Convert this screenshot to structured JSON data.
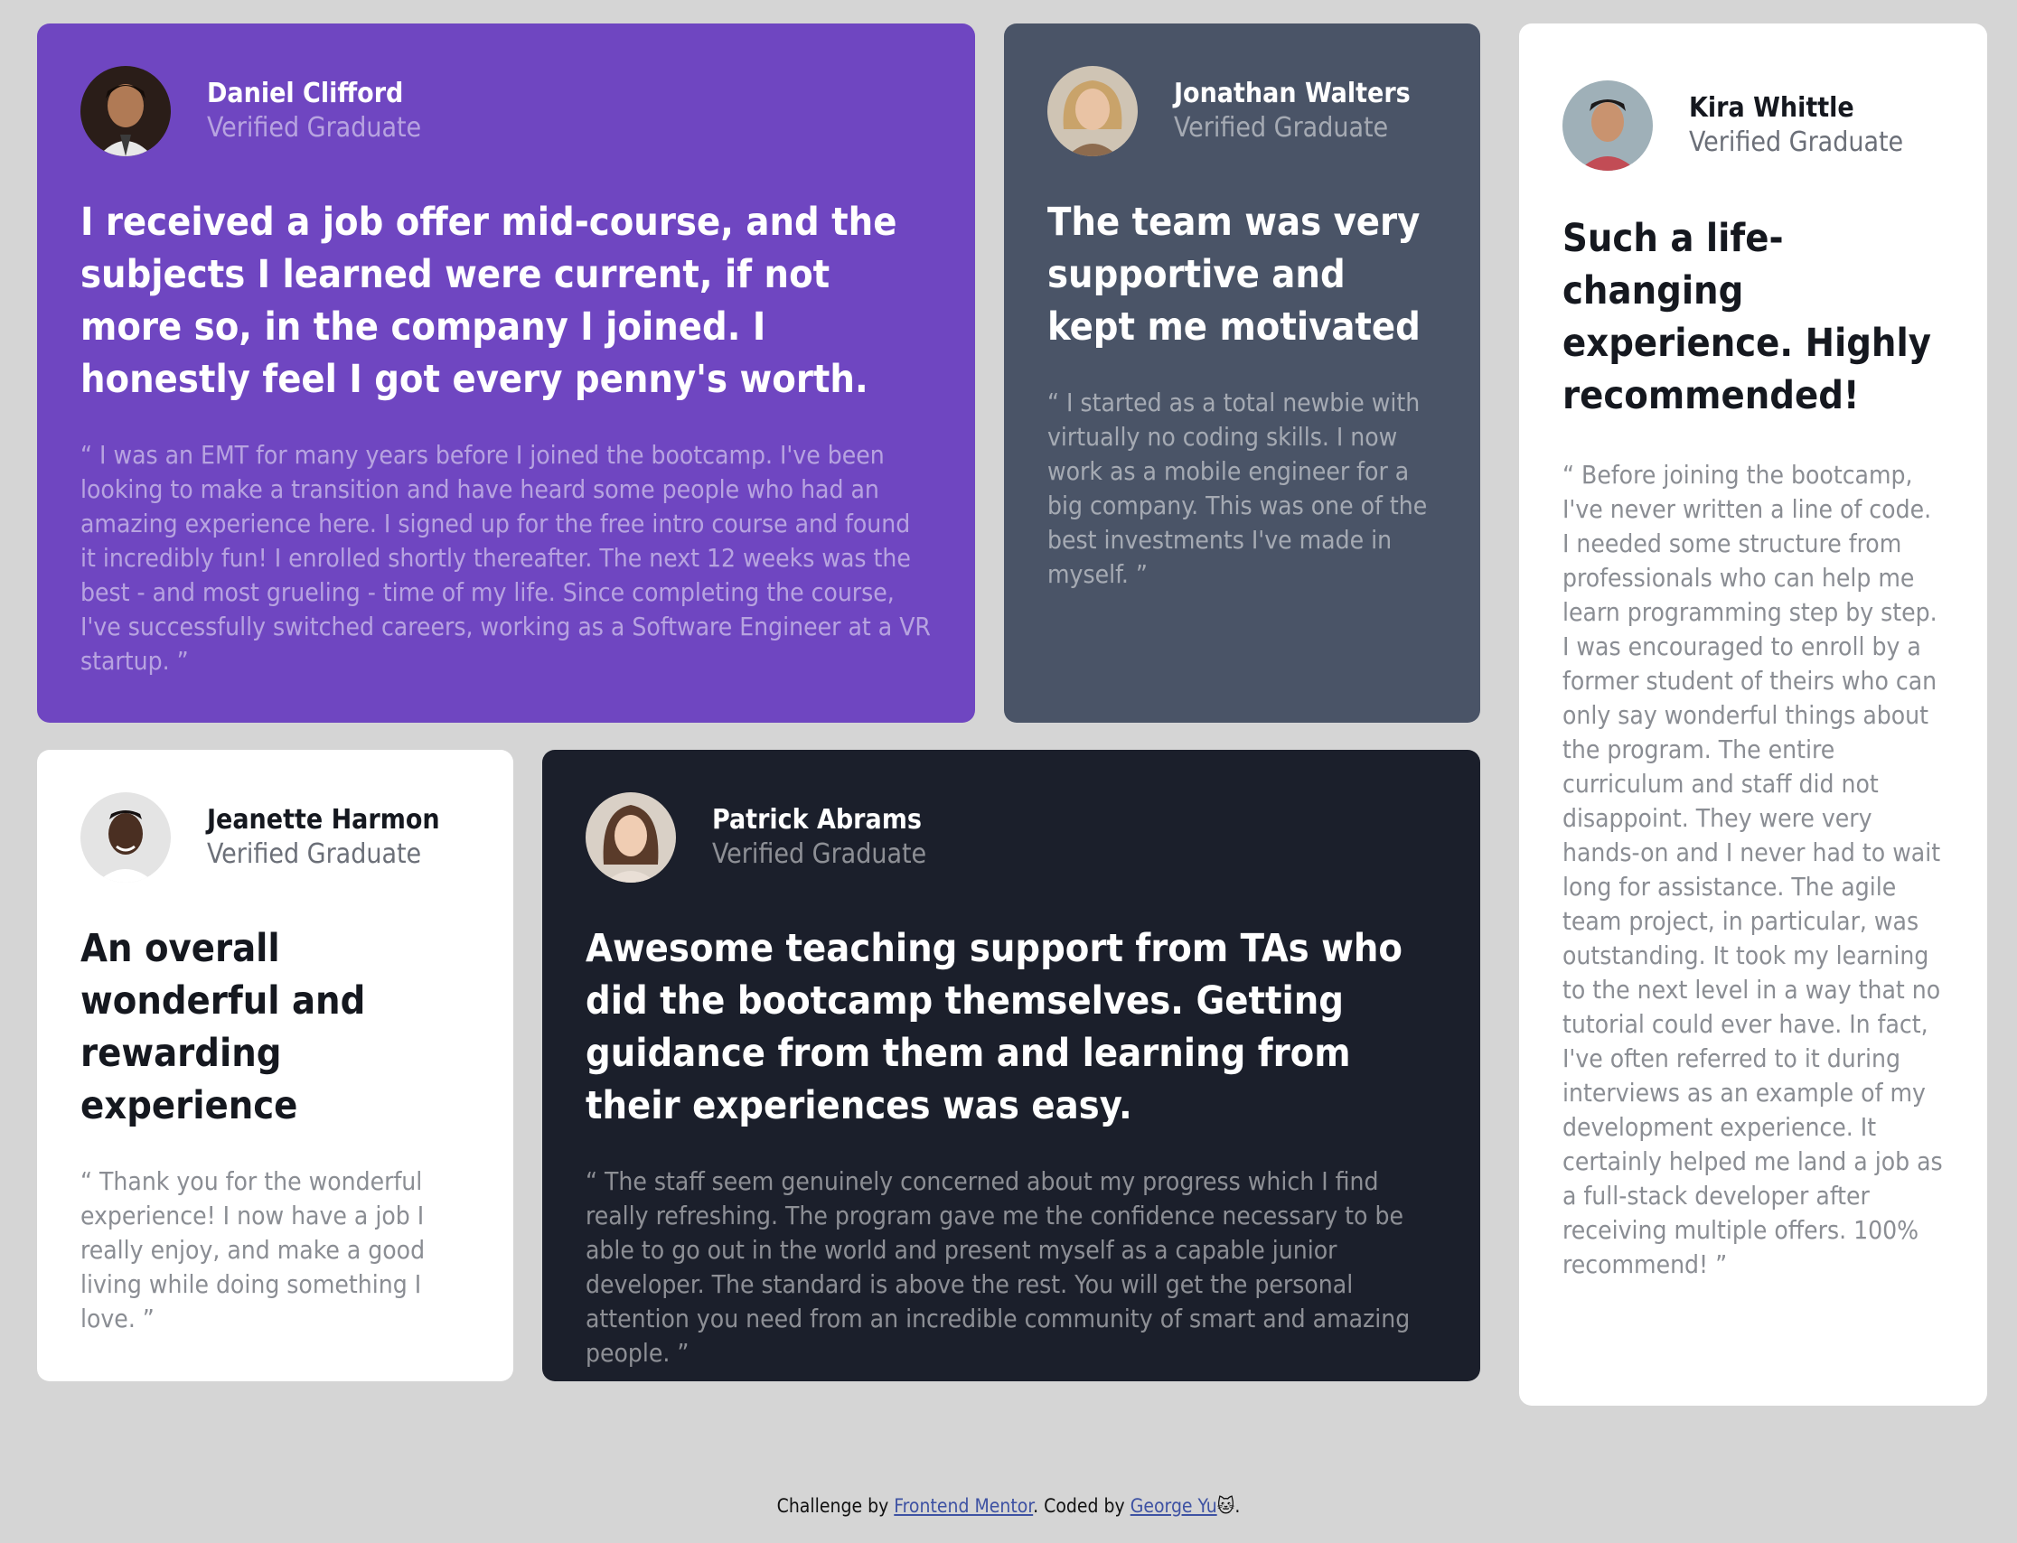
{
  "testimonials": [
    {
      "name": "Daniel Clifford",
      "role": "Verified Graduate",
      "headline": "I received a job offer mid-course, and the subjects I learned were current, if not more so, in the company I joined. I honestly feel I got every penny's worth.",
      "quote": "“ I was an EMT for many years before I joined the bootcamp. I've been looking to make a transition and have heard some people who had an amazing experience here. I signed up for the free intro course and found it incredibly fun! I enrolled shortly thereafter. The next 12 weeks was the best - and most grueling - time of my life. Since completing the course, I've successfully switched careers, working as a Software Engineer at a VR startup. ”",
      "color": "#6f46c1"
    },
    {
      "name": "Jonathan Walters",
      "role": "Verified Graduate",
      "headline": "The team was very supportive and kept me motivated",
      "quote": "“ I started as a total newbie with virtually no coding skills. I now work as a mobile engineer for a big company. This was one of the best investments I've made in myself. ”",
      "color": "#4a5467"
    },
    {
      "name": "Kira Whittle",
      "role": "Verified Graduate",
      "headline": "Such a life-changing experience. Highly recommended!",
      "quote": "“ Before joining the bootcamp, I've never written a line of code. I needed some structure from professionals who can help me learn programming step by step. I was encouraged to enroll by a former student of theirs who can only say wonderful things about the program. The entire curriculum and staff did not disappoint. They were very hands-on and I never had to wait long for assistance. The agile team project, in particular, was outstanding. It took my learning to the next level in a way that no tutorial could ever have. In fact, I've often referred to it during interviews as an example of my development experience. It certainly helped me land a job as a full-stack developer after receiving multiple offers. 100% recommend! ”",
      "color": "#ffffff"
    },
    {
      "name": "Jeanette Harmon",
      "role": "Verified Graduate",
      "headline": "An overall wonderful and rewarding experience",
      "quote": "“ Thank you for the wonderful experience! I now have a job I really enjoy, and make a good living while doing something I love. ”",
      "color": "#ffffff"
    },
    {
      "name": "Patrick Abrams",
      "role": "Verified Graduate",
      "headline": "Awesome teaching support from TAs who did the bootcamp themselves. Getting guidance from them and learning from their experiences was easy.",
      "quote": "“ The staff seem genuinely concerned about my progress which I find really refreshing. The program gave me the confidence necessary to be able to go out in the world and present myself as a capable junior developer. The standard is above the rest. You will get the personal attention you need from an incredible community of smart and amazing people. ”",
      "color": "#1b1f2b"
    }
  ],
  "footer": {
    "prefix": "Challenge by ",
    "link1": "Frontend Mentor",
    "middle": ". Coded by ",
    "link2": "George Yu",
    "emoji": "🐱",
    "suffix": "."
  }
}
